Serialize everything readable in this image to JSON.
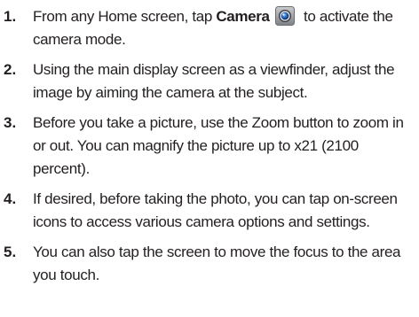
{
  "steps": [
    {
      "number": "1.",
      "text_before": "From any Home screen, tap ",
      "bold_term": "Camera",
      "icon": "camera-app-icon",
      "text_after": " to activate the camera mode."
    },
    {
      "number": "2.",
      "text": "Using the main display screen as a viewfinder, adjust the image by aiming the camera at the subject."
    },
    {
      "number": "3.",
      "text": "Before you take a picture, use the Zoom button to zoom in or out. You can magnify the picture up to x21 (2100 percent)."
    },
    {
      "number": "4.",
      "text": "If desired, before taking the photo, you can tap on-screen icons to access various camera options and settings."
    },
    {
      "number": "5.",
      "text": "You can also tap the screen to move the focus to the area you touch."
    }
  ]
}
